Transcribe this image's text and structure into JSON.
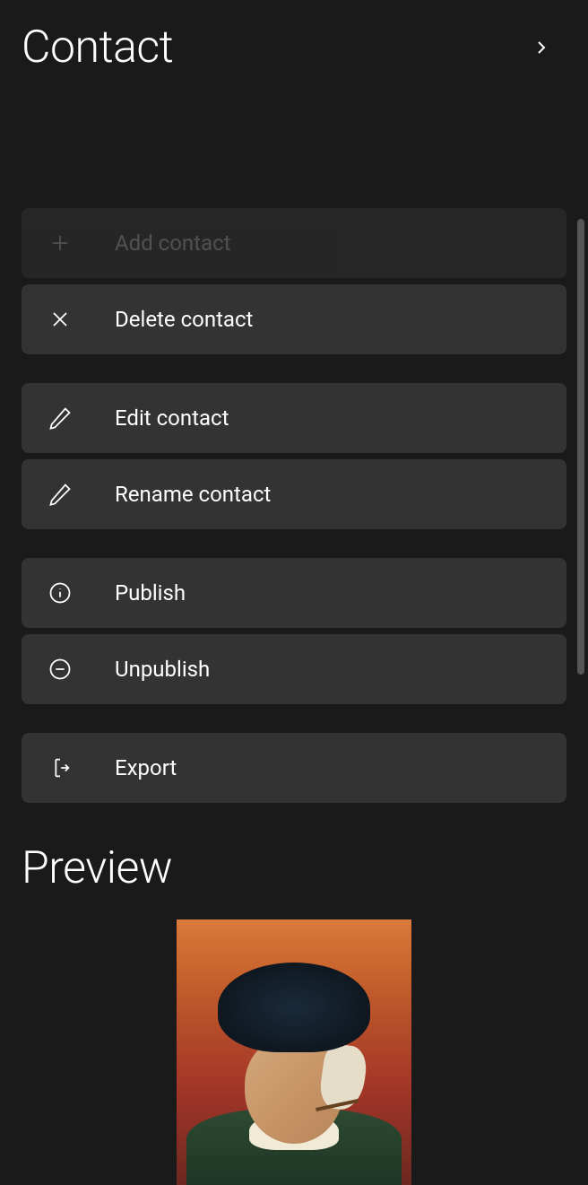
{
  "header": {
    "title": "Contact"
  },
  "actions": {
    "group1": [
      {
        "id": "add",
        "label": "Add contact",
        "icon": "plus",
        "disabled": true
      },
      {
        "id": "delete",
        "label": "Delete contact",
        "icon": "close",
        "disabled": false
      }
    ],
    "group2": [
      {
        "id": "edit",
        "label": "Edit contact",
        "icon": "pencil",
        "disabled": false
      },
      {
        "id": "rename",
        "label": "Rename contact",
        "icon": "pencil",
        "disabled": false
      }
    ],
    "group3": [
      {
        "id": "publish",
        "label": "Publish",
        "icon": "info",
        "disabled": false
      },
      {
        "id": "unpublish",
        "label": "Unpublish",
        "icon": "minus-circle",
        "disabled": false
      }
    ],
    "group4": [
      {
        "id": "export",
        "label": "Export",
        "icon": "export",
        "disabled": false
      }
    ]
  },
  "preview": {
    "title": "Preview"
  }
}
